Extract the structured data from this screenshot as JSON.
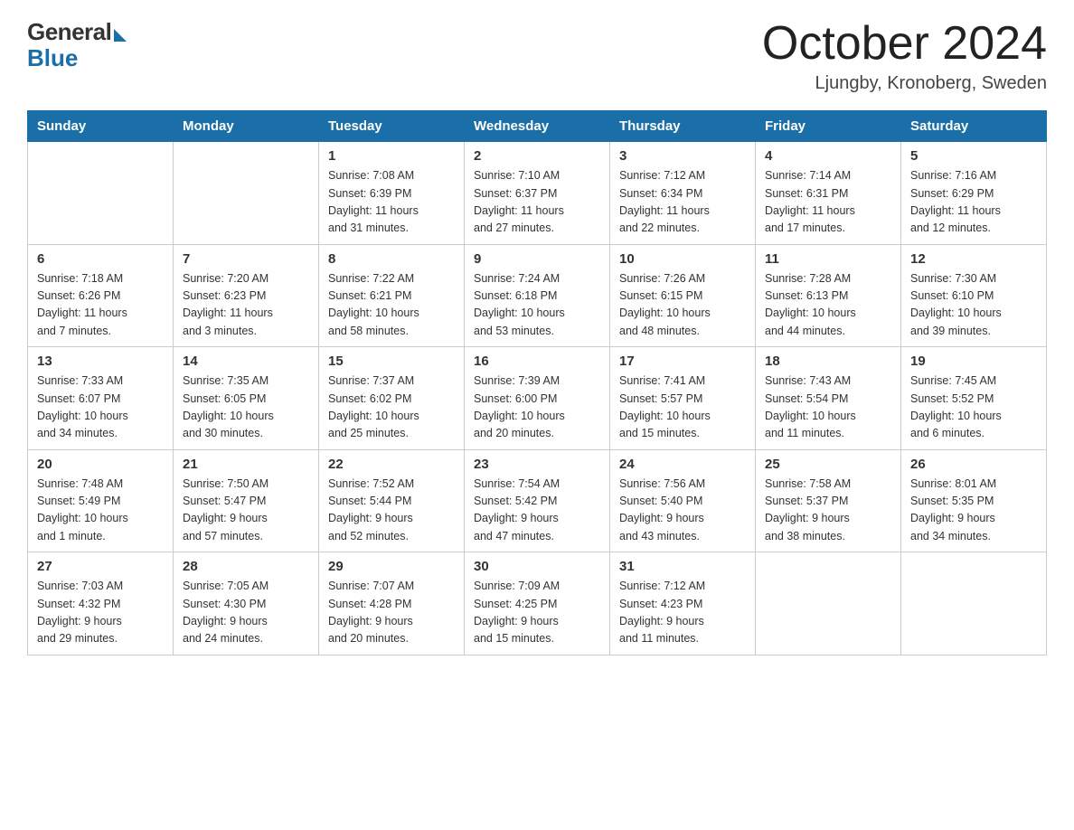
{
  "header": {
    "logo_general": "General",
    "logo_blue": "Blue",
    "month_title": "October 2024",
    "location": "Ljungby, Kronoberg, Sweden"
  },
  "days_of_week": [
    "Sunday",
    "Monday",
    "Tuesday",
    "Wednesday",
    "Thursday",
    "Friday",
    "Saturday"
  ],
  "weeks": [
    [
      {
        "day": "",
        "info": ""
      },
      {
        "day": "",
        "info": ""
      },
      {
        "day": "1",
        "info": "Sunrise: 7:08 AM\nSunset: 6:39 PM\nDaylight: 11 hours\nand 31 minutes."
      },
      {
        "day": "2",
        "info": "Sunrise: 7:10 AM\nSunset: 6:37 PM\nDaylight: 11 hours\nand 27 minutes."
      },
      {
        "day": "3",
        "info": "Sunrise: 7:12 AM\nSunset: 6:34 PM\nDaylight: 11 hours\nand 22 minutes."
      },
      {
        "day": "4",
        "info": "Sunrise: 7:14 AM\nSunset: 6:31 PM\nDaylight: 11 hours\nand 17 minutes."
      },
      {
        "day": "5",
        "info": "Sunrise: 7:16 AM\nSunset: 6:29 PM\nDaylight: 11 hours\nand 12 minutes."
      }
    ],
    [
      {
        "day": "6",
        "info": "Sunrise: 7:18 AM\nSunset: 6:26 PM\nDaylight: 11 hours\nand 7 minutes."
      },
      {
        "day": "7",
        "info": "Sunrise: 7:20 AM\nSunset: 6:23 PM\nDaylight: 11 hours\nand 3 minutes."
      },
      {
        "day": "8",
        "info": "Sunrise: 7:22 AM\nSunset: 6:21 PM\nDaylight: 10 hours\nand 58 minutes."
      },
      {
        "day": "9",
        "info": "Sunrise: 7:24 AM\nSunset: 6:18 PM\nDaylight: 10 hours\nand 53 minutes."
      },
      {
        "day": "10",
        "info": "Sunrise: 7:26 AM\nSunset: 6:15 PM\nDaylight: 10 hours\nand 48 minutes."
      },
      {
        "day": "11",
        "info": "Sunrise: 7:28 AM\nSunset: 6:13 PM\nDaylight: 10 hours\nand 44 minutes."
      },
      {
        "day": "12",
        "info": "Sunrise: 7:30 AM\nSunset: 6:10 PM\nDaylight: 10 hours\nand 39 minutes."
      }
    ],
    [
      {
        "day": "13",
        "info": "Sunrise: 7:33 AM\nSunset: 6:07 PM\nDaylight: 10 hours\nand 34 minutes."
      },
      {
        "day": "14",
        "info": "Sunrise: 7:35 AM\nSunset: 6:05 PM\nDaylight: 10 hours\nand 30 minutes."
      },
      {
        "day": "15",
        "info": "Sunrise: 7:37 AM\nSunset: 6:02 PM\nDaylight: 10 hours\nand 25 minutes."
      },
      {
        "day": "16",
        "info": "Sunrise: 7:39 AM\nSunset: 6:00 PM\nDaylight: 10 hours\nand 20 minutes."
      },
      {
        "day": "17",
        "info": "Sunrise: 7:41 AM\nSunset: 5:57 PM\nDaylight: 10 hours\nand 15 minutes."
      },
      {
        "day": "18",
        "info": "Sunrise: 7:43 AM\nSunset: 5:54 PM\nDaylight: 10 hours\nand 11 minutes."
      },
      {
        "day": "19",
        "info": "Sunrise: 7:45 AM\nSunset: 5:52 PM\nDaylight: 10 hours\nand 6 minutes."
      }
    ],
    [
      {
        "day": "20",
        "info": "Sunrise: 7:48 AM\nSunset: 5:49 PM\nDaylight: 10 hours\nand 1 minute."
      },
      {
        "day": "21",
        "info": "Sunrise: 7:50 AM\nSunset: 5:47 PM\nDaylight: 9 hours\nand 57 minutes."
      },
      {
        "day": "22",
        "info": "Sunrise: 7:52 AM\nSunset: 5:44 PM\nDaylight: 9 hours\nand 52 minutes."
      },
      {
        "day": "23",
        "info": "Sunrise: 7:54 AM\nSunset: 5:42 PM\nDaylight: 9 hours\nand 47 minutes."
      },
      {
        "day": "24",
        "info": "Sunrise: 7:56 AM\nSunset: 5:40 PM\nDaylight: 9 hours\nand 43 minutes."
      },
      {
        "day": "25",
        "info": "Sunrise: 7:58 AM\nSunset: 5:37 PM\nDaylight: 9 hours\nand 38 minutes."
      },
      {
        "day": "26",
        "info": "Sunrise: 8:01 AM\nSunset: 5:35 PM\nDaylight: 9 hours\nand 34 minutes."
      }
    ],
    [
      {
        "day": "27",
        "info": "Sunrise: 7:03 AM\nSunset: 4:32 PM\nDaylight: 9 hours\nand 29 minutes."
      },
      {
        "day": "28",
        "info": "Sunrise: 7:05 AM\nSunset: 4:30 PM\nDaylight: 9 hours\nand 24 minutes."
      },
      {
        "day": "29",
        "info": "Sunrise: 7:07 AM\nSunset: 4:28 PM\nDaylight: 9 hours\nand 20 minutes."
      },
      {
        "day": "30",
        "info": "Sunrise: 7:09 AM\nSunset: 4:25 PM\nDaylight: 9 hours\nand 15 minutes."
      },
      {
        "day": "31",
        "info": "Sunrise: 7:12 AM\nSunset: 4:23 PM\nDaylight: 9 hours\nand 11 minutes."
      },
      {
        "day": "",
        "info": ""
      },
      {
        "day": "",
        "info": ""
      }
    ]
  ]
}
